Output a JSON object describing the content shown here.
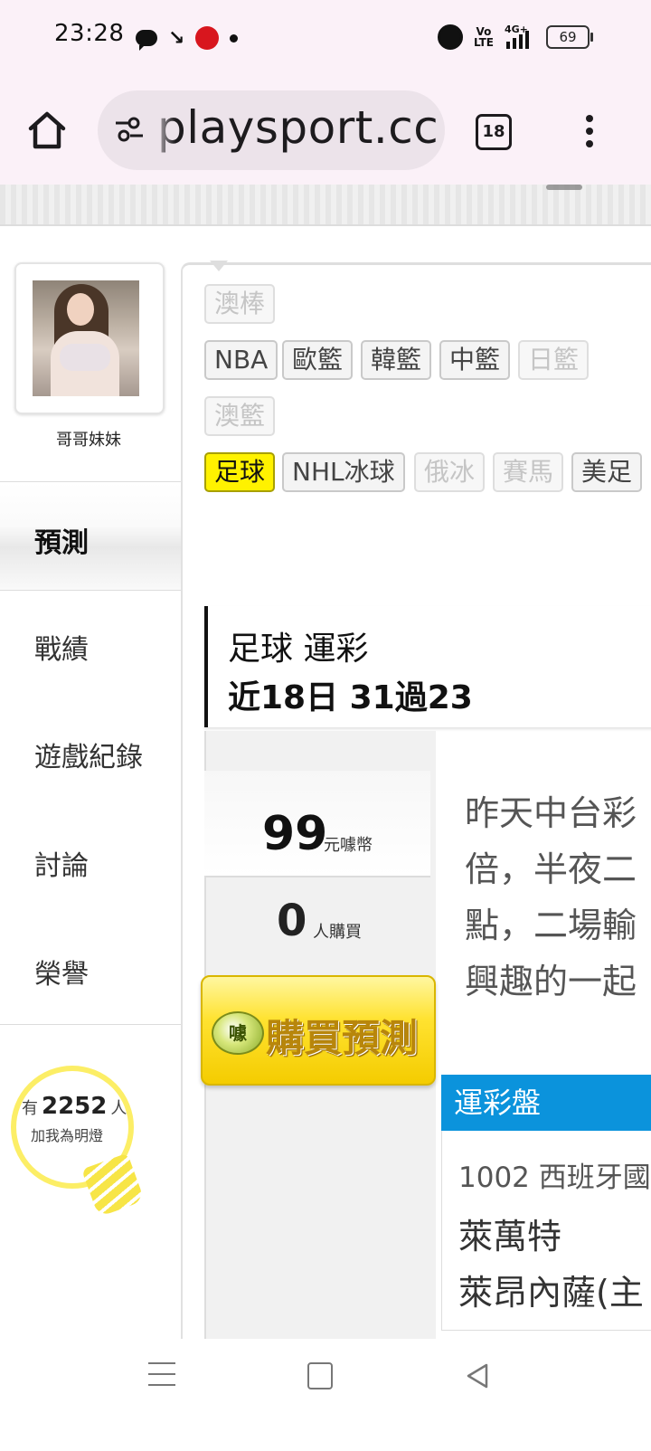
{
  "status_bar": {
    "time": "23:28",
    "volte_label": "Vo\nLTE",
    "network_label": "4G+",
    "battery": "69",
    "battery_level": 0.69
  },
  "browser": {
    "url": "playsport.cc",
    "tab_count": "18"
  },
  "profile": {
    "username": "哥哥妹妹"
  },
  "sidebar": {
    "items": [
      {
        "label": "預測",
        "active": true
      },
      {
        "label": "戰績"
      },
      {
        "label": "遊戲紀錄"
      },
      {
        "label": "討論"
      },
      {
        "label": "榮譽"
      }
    ]
  },
  "fans": {
    "prefix": "有",
    "count": "2252",
    "suffix": "人",
    "caption": "加我為明燈"
  },
  "sport_tags": [
    {
      "label": "澳棒",
      "state": "disabled"
    },
    {
      "label": "NBA"
    },
    {
      "label": "歐籃"
    },
    {
      "label": "韓籃"
    },
    {
      "label": "中籃"
    },
    {
      "label": "日籃",
      "state": "disabled"
    },
    {
      "label": "澳籃",
      "state": "disabled"
    },
    {
      "label": "足球",
      "state": "active"
    },
    {
      "label": "NHL冰球"
    },
    {
      "label": "俄冰",
      "state": "disabled"
    },
    {
      "label": "賽馬",
      "state": "disabled"
    },
    {
      "label": "美足"
    }
  ],
  "section": {
    "title": "足球 運彩",
    "record": "近18日 31過23"
  },
  "prediction": {
    "price": "99",
    "price_unit": "元噱幣",
    "buyers": "0",
    "buyers_unit": "人購買",
    "buy_button": "購買預測",
    "coin_label": "噱",
    "description_lines": [
      "昨天中台彩",
      "倍，半夜二",
      "點，二場輸",
      "興趣的一起"
    ]
  },
  "lottery": {
    "header": "運彩盤",
    "code": "1002 西班牙國",
    "team1": "萊萬特",
    "team2": "萊昂內薩(主"
  }
}
